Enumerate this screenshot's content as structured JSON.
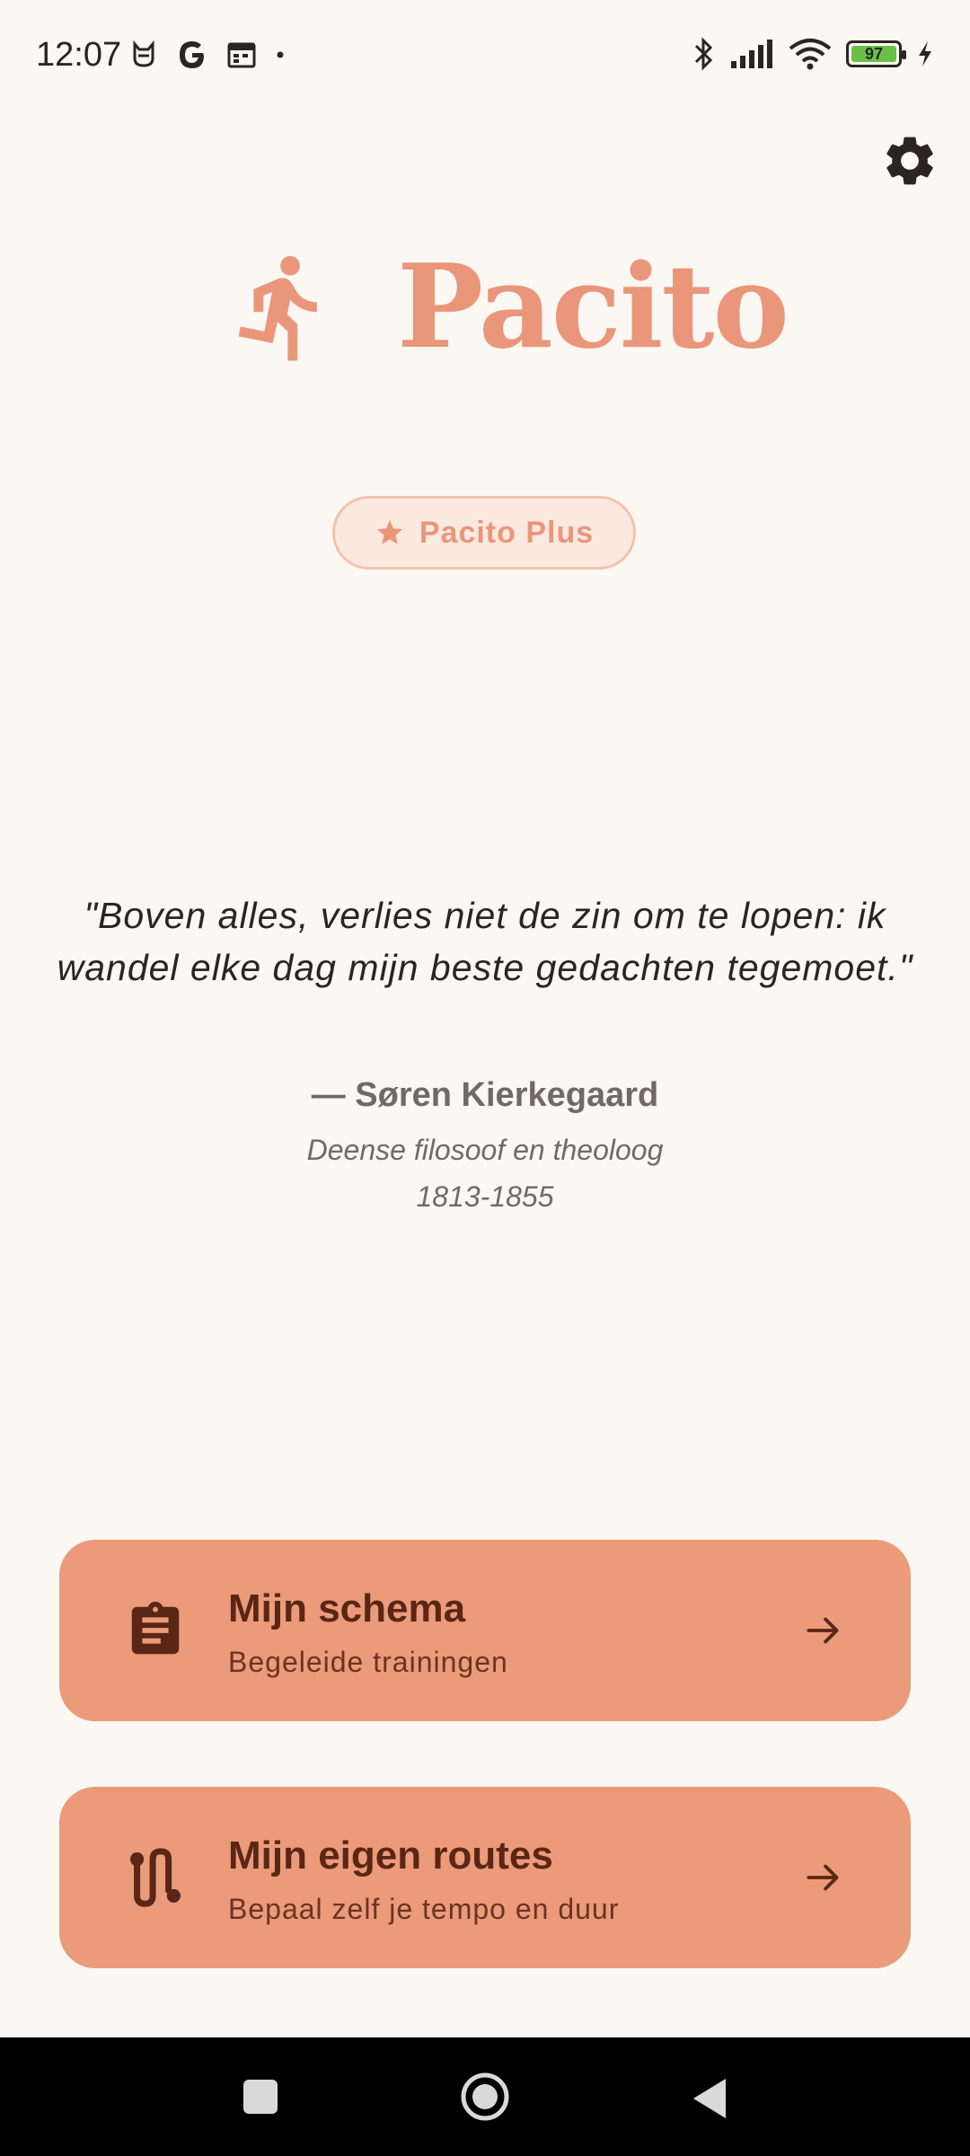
{
  "status_bar": {
    "time": "12:07",
    "left_icons": [
      "cat-icon",
      "google-icon",
      "calendar-icon",
      "dot-icon"
    ],
    "right_icons": [
      "bluetooth-icon",
      "signal-icon",
      "wifi-icon",
      "battery-icon",
      "charging-icon"
    ],
    "battery_level": "97"
  },
  "header": {
    "settings_icon": "gear-icon"
  },
  "logo": {
    "icon": "runner-icon",
    "text": "Pacito",
    "color": "#e9967a"
  },
  "plus_button": {
    "icon": "star-icon",
    "label": "Pacito Plus"
  },
  "quote": {
    "text": "\"Boven alles, verlies niet de zin om te lopen: ik wandel elke dag mijn beste gedachten tegemoet.\"",
    "author": "— Søren Kierkegaard",
    "description": "Deense filosoof en theoloog",
    "years": "1813-1855"
  },
  "cards": [
    {
      "icon": "clipboard-icon",
      "title": "Mijn schema",
      "subtitle": "Begeleide trainingen",
      "arrow_icon": "arrow-right-icon"
    },
    {
      "icon": "route-icon",
      "title": "Mijn eigen routes",
      "subtitle": "Bepaal zelf je tempo en duur",
      "arrow_icon": "arrow-right-icon"
    }
  ],
  "nav_bar": {
    "buttons": [
      "recents-square-icon",
      "home-circle-icon",
      "back-triangle-icon"
    ]
  },
  "colors": {
    "background": "#fbf7f2",
    "accent": "#e9967a",
    "card": "#eb9a7a",
    "card_text": "#5a2616"
  }
}
